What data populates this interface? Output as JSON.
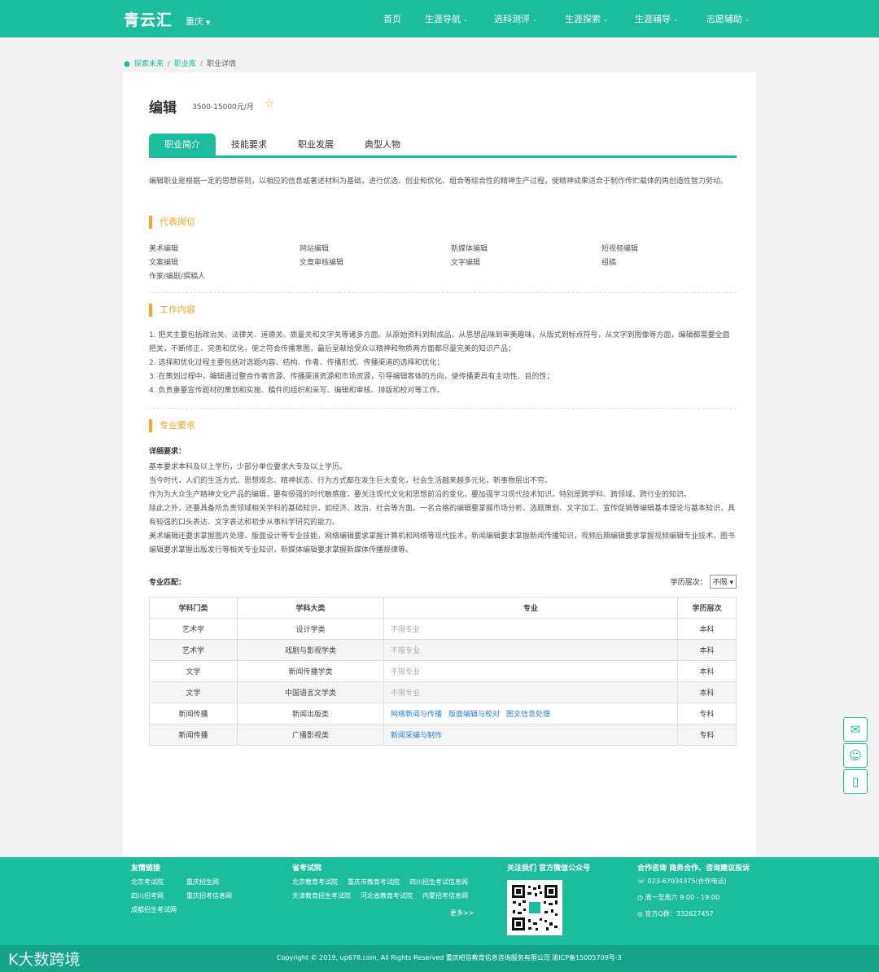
{
  "header": {
    "logo": "青云汇",
    "city": "重庆",
    "nav": [
      "首页",
      "生涯导航",
      "选科测评",
      "生涯探索",
      "生涯辅导",
      "志愿辅助"
    ]
  },
  "breadcrumb": [
    "探索未来",
    "职业库",
    "职业详情"
  ],
  "job": {
    "title": "编辑",
    "salary": "3500-15000元/月",
    "star": "☆"
  },
  "tabs": [
    "职业简介",
    "技能要求",
    "职业发展",
    "典型人物"
  ],
  "intro": "编辑职业是根据一定的思想原则，以相应的信息或著述材料为基础，进行优选、创业和优化、组合等综合性的精神生产过程，使精神成果适合于制作传贮载体的再创造性智力劳动。",
  "positions_title": "代表岗位",
  "positions": [
    "美术编辑",
    "网站编辑",
    "新媒体编辑",
    "短视频编辑",
    "文案编辑",
    "文章审核编辑",
    "文字编辑",
    "组稿",
    "作家/编剧/撰稿人"
  ],
  "work_title": "工作内容",
  "work_items": [
    "1. 把关主要包括政治关、法律关、道德关、质量关和文字关等诸多方面。从原始资料到制成品，从思想品味到审美趣味，从版式到标点符号，从文字到图像等方面，编辑都需要全面把关，不断修正、完善和优化，使之符合传播意图，最后呈献给受众以精神和物质两方面都尽量完美的知识产品；",
    "2. 选择和优化过程主要包括对选题内容、结构、作者、传播形式、传播渠道的选择和优化；",
    "3. 在策划过程中，编辑通过整合作者资源、传播渠道资源和市场资源，引导编辑客体的方向，使传播更具有主动性、目的性；",
    "4. 负责重要宣传题材的策划和实施、稿件的组织和采写、编辑和审核、排版和校对等工作。"
  ],
  "req_title": "专业要求",
  "req_label": "详细要求：",
  "req_lines": [
    "基本要求本科及以上学历，少部分单位要求大专及以上学历。",
    "当今时代，人们的生活方式、思想观念、精神状态、行为方式都在发生巨大变化，社会生活越来越多元化，新事物层出不穷。",
    "作为为大众生产精神文化产品的编辑，要有很强的时代敏感度，要关注现代文化和思想前沿的变化，要加强学习现代技术知识，特别是跨学科、跨领域、跨行业的知识。",
    "除此之外，还要具备所负责领域相关学科的基础知识，如经济、政治、社会等方面。一名合格的编辑要掌握市场分析、选题策划、文字加工、宣传促销等编辑基本理论与基本知识，具有较强的口头表达、文字表达和初步从事科学研究的能力。",
    "美术编辑还要求掌握图片处理、版面设计等专业技能，网络编辑要求掌握计算机和网络等现代技术，新闻编辑要求掌握新闻传播知识，视频后期编辑要求掌握视频编辑专业技术，图书编辑要求掌握出版发行等相关专业知识，新媒体编辑要求掌握新媒体传播规律等。"
  ],
  "match_label": "专业匹配：",
  "edu_filter": {
    "label": "学历层次：",
    "value": "不限",
    "caret": "▾"
  },
  "table": {
    "headers": [
      "学科门类",
      "学科大类",
      "专业",
      "学历层次"
    ],
    "rows": [
      {
        "cat": "艺术学",
        "sub": "设计学类",
        "majors": [
          "不限专业"
        ],
        "unlimited": true,
        "level": "本科"
      },
      {
        "cat": "艺术学",
        "sub": "戏剧与影视学类",
        "majors": [
          "不限专业"
        ],
        "unlimited": true,
        "level": "本科"
      },
      {
        "cat": "文学",
        "sub": "新闻传播学类",
        "majors": [
          "不限专业"
        ],
        "unlimited": true,
        "level": "本科"
      },
      {
        "cat": "文学",
        "sub": "中国语言文学类",
        "majors": [
          "不限专业"
        ],
        "unlimited": true,
        "level": "本科"
      },
      {
        "cat": "新闻传播",
        "sub": "新闻出版类",
        "majors": [
          "网络新闻与传播",
          "版面编辑与校对",
          "图文信息处理"
        ],
        "unlimited": false,
        "level": "专科"
      },
      {
        "cat": "新闻传播",
        "sub": "广播影视类",
        "majors": [
          "新闻采编与制作"
        ],
        "unlimited": false,
        "level": "专科"
      }
    ]
  },
  "side_widgets": [
    {
      "icon": "wechat-icon",
      "glyph": "✉"
    },
    {
      "icon": "support-icon",
      "glyph": "☺"
    },
    {
      "icon": "phone-icon",
      "glyph": "▯"
    }
  ],
  "footer": {
    "friends_title": "友情链接",
    "friends": [
      "北京考试院",
      "重庆招生网",
      "四川招考网",
      "重庆招考信息网",
      "成都招生考试网"
    ],
    "exam_title": "省考试院",
    "exams": [
      "北京教育考试院",
      "重庆市教育考试院",
      "四川招生考试信息网",
      "天津教育招生考试院",
      "河北省教育考试院",
      "内蒙招考信息网"
    ],
    "more": "更多>>",
    "follow_title": "关注我们 官方微信公众号",
    "contact_title": "合作咨询 商务合作、咨询建议投诉",
    "phone": "023-67034375(合作电话)",
    "hours": "周一至周六 9:00 - 19:00",
    "qq": "官方Q群：332627457",
    "copyright": "Copyright © 2019, up678.com, All Rights Reserved 重庆昭信教育信息咨询服务有限公司 渝ICP备15005709号-3",
    "watermark": "大数跨境"
  }
}
